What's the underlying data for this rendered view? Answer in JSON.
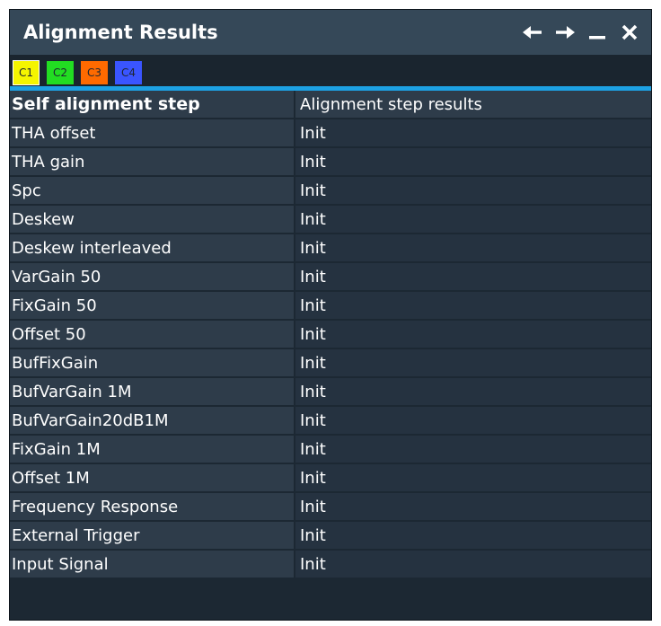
{
  "window": {
    "title": "Alignment Results",
    "controls": [
      {
        "name": "back-arrow-icon",
        "glyph": "←"
      },
      {
        "name": "forward-arrow-icon",
        "glyph": "→"
      },
      {
        "name": "minimize-icon",
        "glyph": "_"
      },
      {
        "name": "close-icon",
        "glyph": "✕"
      }
    ]
  },
  "tabs": [
    {
      "label": "C1",
      "color": "#f5f500",
      "active": true
    },
    {
      "label": "C2",
      "color": "#22dd22",
      "active": false
    },
    {
      "label": "C3",
      "color": "#ff6a00",
      "active": false
    },
    {
      "label": "C4",
      "color": "#3a55ff",
      "active": false
    }
  ],
  "accent_color": "#1da1e3",
  "table": {
    "headers": [
      "Self alignment step",
      "Alignment step results"
    ],
    "rows": [
      {
        "step": "THA offset",
        "result": "Init"
      },
      {
        "step": "THA gain",
        "result": "Init"
      },
      {
        "step": "Spc",
        "result": "Init"
      },
      {
        "step": "Deskew",
        "result": "Init"
      },
      {
        "step": "Deskew interleaved",
        "result": "Init"
      },
      {
        "step": "VarGain 50",
        "result": "Init"
      },
      {
        "step": "FixGain 50",
        "result": "Init"
      },
      {
        "step": "Offset 50",
        "result": "Init"
      },
      {
        "step": "BufFixGain",
        "result": "Init"
      },
      {
        "step": "BufVarGain 1M",
        "result": "Init"
      },
      {
        "step": "BufVarGain20dB1M",
        "result": "Init"
      },
      {
        "step": "FixGain 1M",
        "result": "Init"
      },
      {
        "step": "Offset 1M",
        "result": "Init"
      },
      {
        "step": "Frequency Response",
        "result": "Init"
      },
      {
        "step": "External Trigger",
        "result": "Init"
      },
      {
        "step": "Input Signal",
        "result": "Init"
      }
    ]
  }
}
